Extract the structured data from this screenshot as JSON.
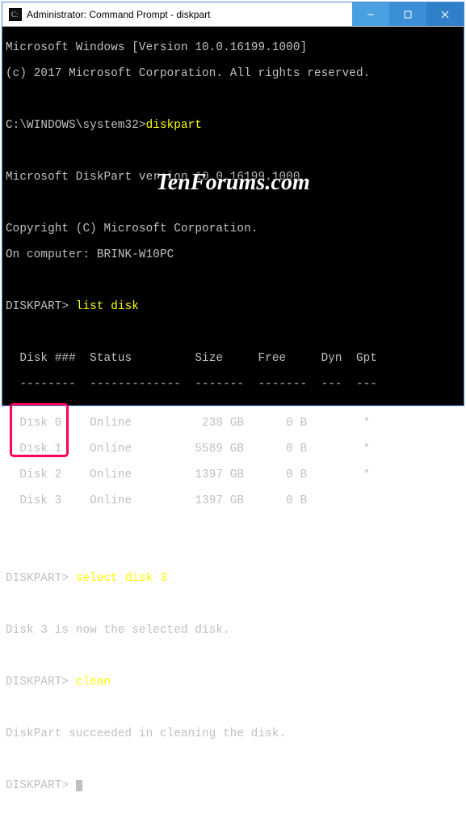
{
  "titlebar": {
    "icon_name": "cmd-icon",
    "title": "Administrator: Command Prompt - diskpart"
  },
  "terminal": {
    "header1": "Microsoft Windows [Version 10.0.16199.1000]",
    "header2": "(c) 2017 Microsoft Corporation. All rights reserved.",
    "prompt1_path": "C:\\WINDOWS\\system32>",
    "prompt1_cmd": "diskpart",
    "dp_version": "Microsoft DiskPart version 10.0.16199.1000",
    "dp_copy": "Copyright (C) Microsoft Corporation.",
    "dp_comp": "On computer: BRINK-W10PC",
    "dp_prompt": "DISKPART>",
    "cmd_list": "list disk",
    "table_header": "  Disk ###  Status         Size     Free     Dyn  Gpt",
    "table_rule": "  --------  -------------  -------  -------  ---  ---",
    "disks": [
      "  Disk 0    Online          238 GB      0 B        *",
      "  Disk 1    Online         5589 GB      0 B        *",
      "  Disk 2    Online         1397 GB      0 B        *",
      "  Disk 3    Online         1397 GB      0 B"
    ],
    "cmd_select": "select disk 3",
    "msg_select": "Disk 3 is now the selected disk.",
    "cmd_clean": "clean",
    "msg_clean": "DiskPart succeeded in cleaning the disk."
  },
  "watermark": "TenForums.com",
  "chart_data": {
    "type": "table",
    "title": "list disk",
    "columns": [
      "Disk ###",
      "Status",
      "Size",
      "Free",
      "Dyn",
      "Gpt"
    ],
    "rows": [
      {
        "disk": "Disk 0",
        "status": "Online",
        "size": "238 GB",
        "free": "0 B",
        "dyn": "",
        "gpt": "*"
      },
      {
        "disk": "Disk 1",
        "status": "Online",
        "size": "5589 GB",
        "free": "0 B",
        "dyn": "",
        "gpt": "*"
      },
      {
        "disk": "Disk 2",
        "status": "Online",
        "size": "1397 GB",
        "free": "0 B",
        "dyn": "",
        "gpt": "*"
      },
      {
        "disk": "Disk 3",
        "status": "Online",
        "size": "1397 GB",
        "free": "0 B",
        "dyn": "",
        "gpt": ""
      }
    ]
  }
}
